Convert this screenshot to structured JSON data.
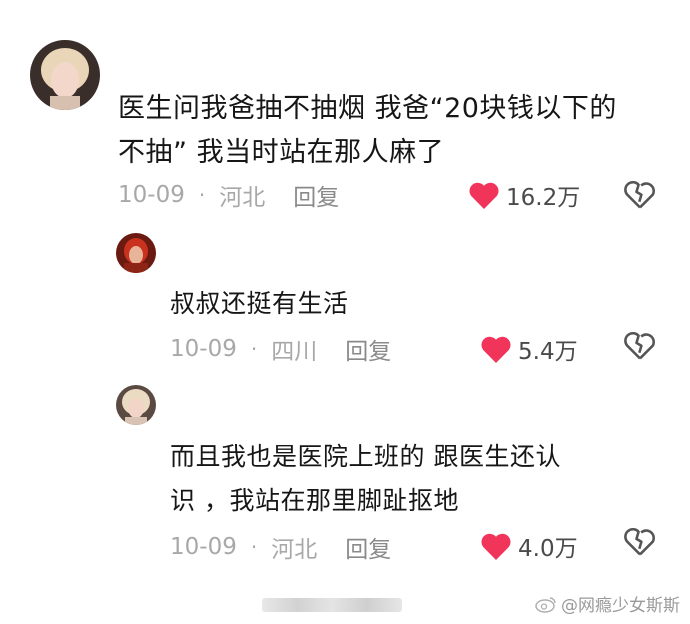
{
  "comments": [
    {
      "lines": [
        "医生问我爸抽不抽烟 我爸“20块钱以下的",
        "不抽” 我当时站在那人麻了"
      ],
      "date": "10-09",
      "separator": "·",
      "region": "河北",
      "reply_label": "回复",
      "likes": "16.2万"
    },
    {
      "lines": [
        "叔叔还挺有生活"
      ],
      "date": "10-09",
      "separator": "·",
      "region": "四川",
      "reply_label": "回复",
      "likes": "5.4万"
    },
    {
      "lines": [
        "而且我也是医院上班的 跟医生还认",
        "识 ，我站在那里脚趾抠地"
      ],
      "date": "10-09",
      "separator": "·",
      "region": "河北",
      "reply_label": "回复",
      "likes": "4.0万"
    }
  ],
  "watermark": "@网瘾少女斯斯",
  "colors": {
    "like_heart": "#f0345a",
    "meta_gray": "#a8a8a8",
    "text": "#161616"
  }
}
